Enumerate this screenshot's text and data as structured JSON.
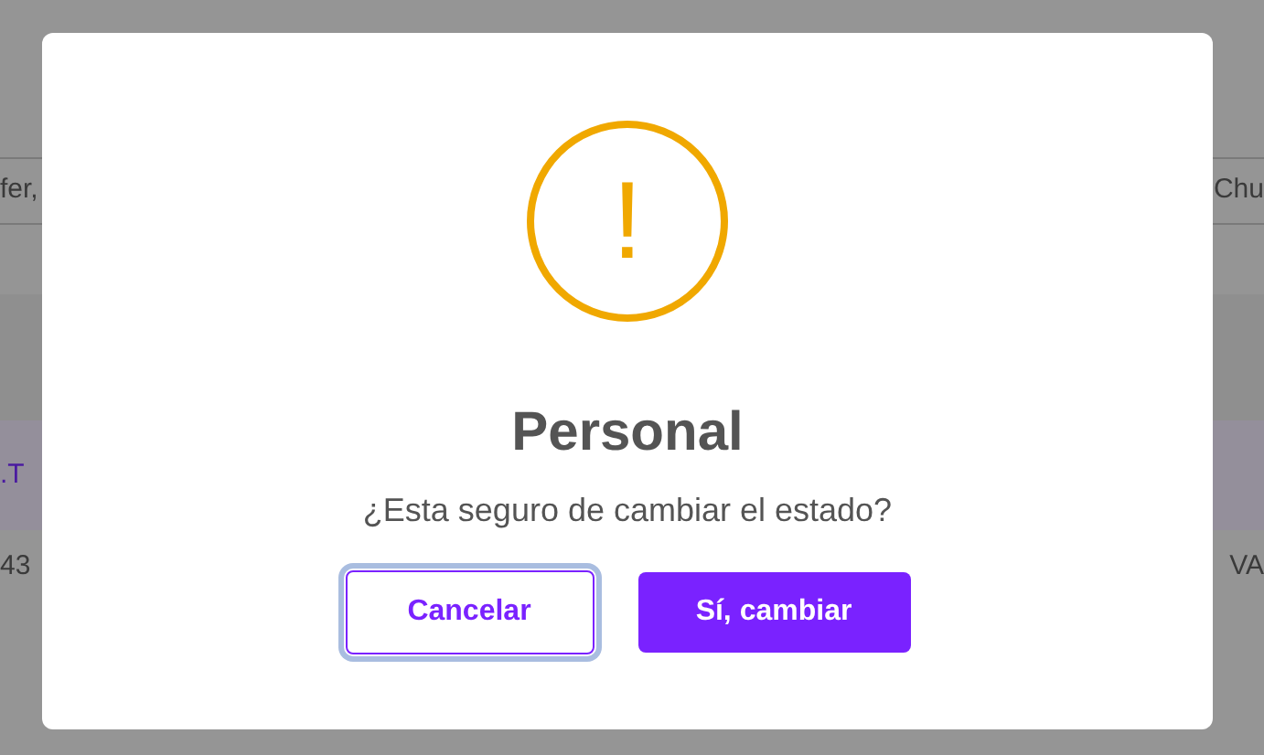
{
  "background": {
    "left_fragments": [
      "fer,",
      ".T",
      "43"
    ],
    "right_fragments": [
      "Chu",
      "VA"
    ]
  },
  "dialog": {
    "icon": "!",
    "title": "Personal",
    "message": "¿Esta seguro de cambiar el estado?",
    "buttons": [
      {
        "label": "Cancelar",
        "kind": "cancel",
        "focused": true
      },
      {
        "label": "Sí, cambiar",
        "kind": "confirm",
        "focused": false
      }
    ]
  }
}
